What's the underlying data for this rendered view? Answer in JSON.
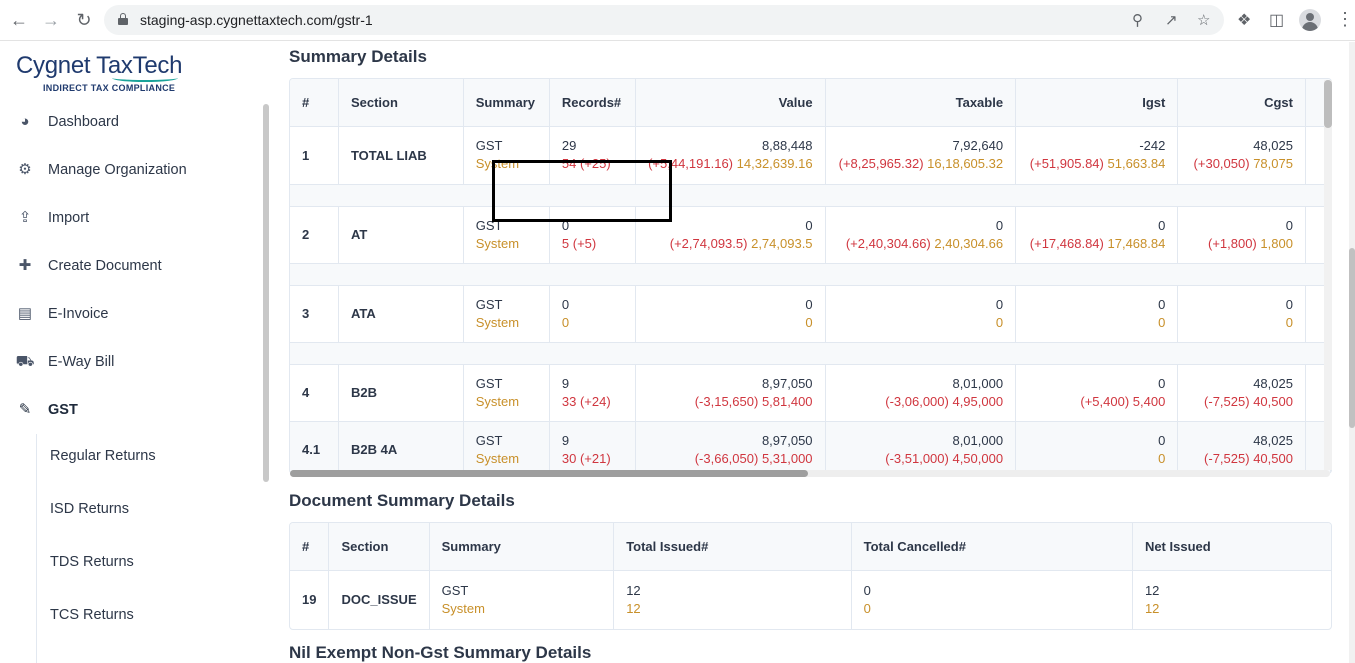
{
  "browser": {
    "url": "staging-asp.cygnettaxtech.com/gstr-1"
  },
  "sidebar": {
    "logo_main": "Cygnet TaxTech",
    "logo_sub": "INDIRECT TAX COMPLIANCE",
    "items": [
      {
        "label": "Dashboard",
        "icon": "dashboard-icon"
      },
      {
        "label": "Manage Organization",
        "icon": "organization-icon"
      },
      {
        "label": "Import",
        "icon": "import-icon"
      },
      {
        "label": "Create Document",
        "icon": "create-document-icon"
      },
      {
        "label": "E-Invoice",
        "icon": "invoice-icon"
      },
      {
        "label": "E-Way Bill",
        "icon": "truck-icon"
      },
      {
        "label": "GST",
        "icon": "gst-icon"
      }
    ],
    "sub_items": [
      "Regular Returns",
      "ISD Returns",
      "TDS Returns",
      "TCS Returns"
    ]
  },
  "summary": {
    "title": "Summary Details",
    "headers": [
      "#",
      "Section",
      "Summary",
      "Records#",
      "Value",
      "Taxable",
      "Igst",
      "Cgst"
    ],
    "rows": [
      {
        "idx": "1",
        "section": "TOTAL LIAB",
        "s1": "GST",
        "s2": "System",
        "rec1": "29",
        "rec2": "54 (+25)",
        "val1": "8,88,448",
        "val2a": "(+5,44,191.16)",
        "val2b": "14,32,639.16",
        "tax1": "7,92,640",
        "tax2a": "(+8,25,965.32)",
        "tax2b": "16,18,605.32",
        "igst1": "-242",
        "igst2a": "(+51,905.84)",
        "igst2b": "51,663.84",
        "cgst1": "48,025",
        "cgst2a": "(+30,050)",
        "cgst2b": "78,075"
      },
      {
        "idx": "2",
        "section": "AT",
        "s1": "GST",
        "s2": "System",
        "rec1": "0",
        "rec2": "5 (+5)",
        "val1": "0",
        "val2a": "(+2,74,093.5)",
        "val2b": "2,74,093.5",
        "tax1": "0",
        "tax2a": "(+2,40,304.66)",
        "tax2b": "2,40,304.66",
        "igst1": "0",
        "igst2a": "(+17,468.84)",
        "igst2b": "17,468.84",
        "cgst1": "0",
        "cgst2a": "(+1,800)",
        "cgst2b": "1,800"
      },
      {
        "idx": "3",
        "section": "ATA",
        "s1": "GST",
        "s2": "System",
        "rec1": "0",
        "rec2": "0",
        "val1": "0",
        "val2a": "",
        "val2b": "0",
        "tax1": "0",
        "tax2a": "",
        "tax2b": "0",
        "igst1": "0",
        "igst2a": "",
        "igst2b": "0",
        "cgst1": "0",
        "cgst2a": "",
        "cgst2b": "0"
      },
      {
        "idx": "4",
        "section": "B2B",
        "s1": "GST",
        "s2": "System",
        "rec1": "9",
        "rec2": "33 (+24)",
        "val1": "8,97,050",
        "val2a": "(-3,15,650)",
        "val2b": "5,81,400",
        "tax1": "8,01,000",
        "tax2a": "(-3,06,000)",
        "tax2b": "4,95,000",
        "igst1": "0",
        "igst2a": "(+5,400)",
        "igst2b": "5,400",
        "cgst1": "48,025",
        "cgst2a": "(-7,525)",
        "cgst2b": "40,500"
      },
      {
        "idx": "4.1",
        "section": "B2B 4A",
        "s1": "GST",
        "s2": "System",
        "rec1": "9",
        "rec2": "30 (+21)",
        "val1": "8,97,050",
        "val2a": "(-3,66,050)",
        "val2b": "5,31,000",
        "tax1": "8,01,000",
        "tax2a": "(-3,51,000)",
        "tax2b": "4,50,000",
        "igst1": "0",
        "igst2a": "",
        "igst2b": "0",
        "cgst1": "48,025",
        "cgst2a": "(-7,525)",
        "cgst2b": "40,500"
      }
    ]
  },
  "document_summary": {
    "title": "Document Summary Details",
    "headers": [
      "#",
      "Section",
      "Summary",
      "Total Issued#",
      "Total Cancelled#",
      "Net Issued"
    ],
    "row": {
      "idx": "19",
      "section": "DOC_ISSUE",
      "s1": "GST",
      "s2": "System",
      "issued1": "12",
      "issued2": "12",
      "cancel1": "0",
      "cancel2": "0",
      "net1": "12",
      "net2": "12"
    }
  },
  "nil_exempt": {
    "title": "Nil Exempt Non-Gst Summary Details"
  },
  "colors": {
    "system_text": "#c8902a",
    "difference_text": "#d0363f",
    "header_bg": "#f7f9fb"
  }
}
